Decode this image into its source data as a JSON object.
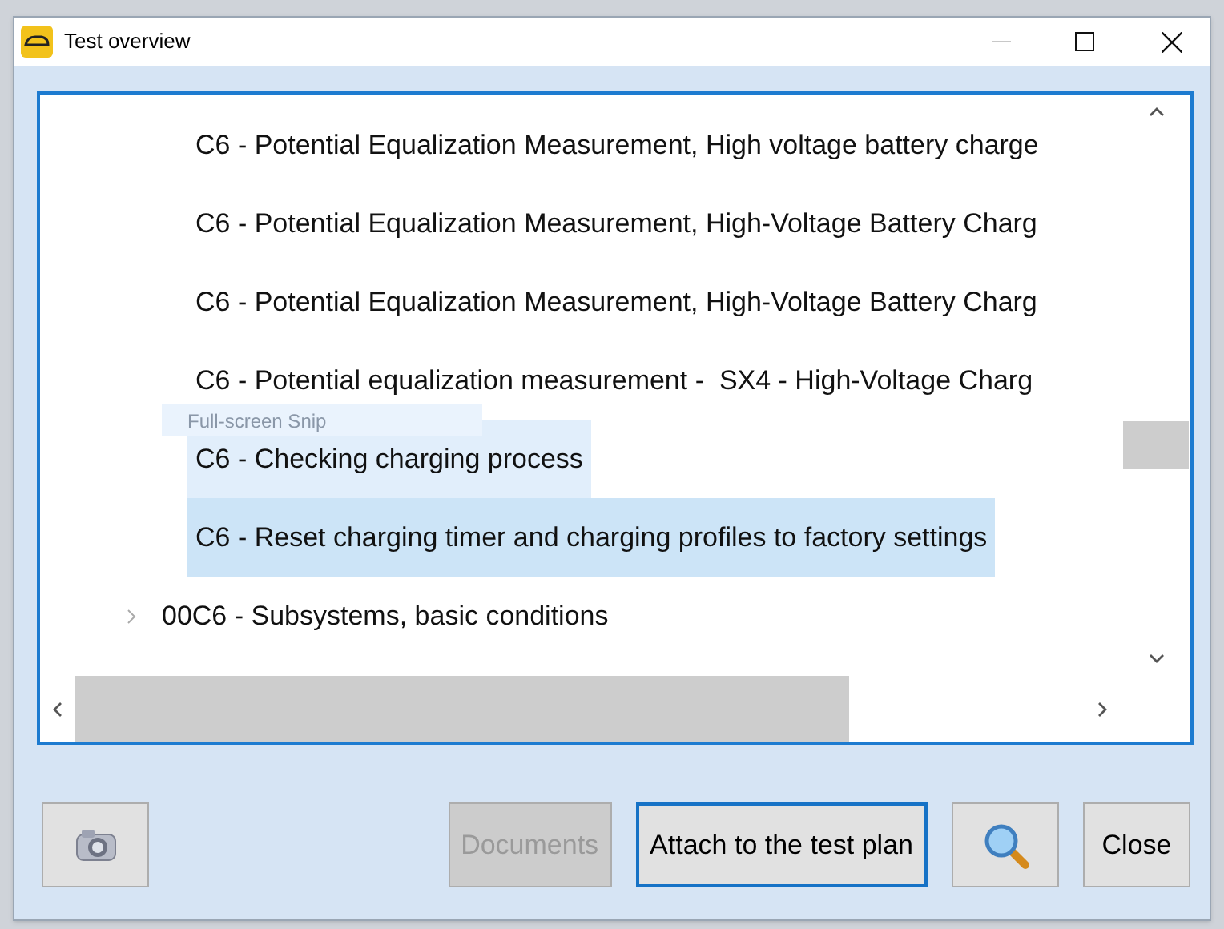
{
  "window": {
    "title": "Test overview"
  },
  "tree": {
    "items": [
      {
        "kind": "leaf",
        "label": "C6 - Potential Equalization Measurement, High voltage battery charge",
        "selected": false,
        "hovered": false
      },
      {
        "kind": "leaf",
        "label": "C6 - Potential Equalization Measurement, High-Voltage Battery Charg",
        "selected": false,
        "hovered": false
      },
      {
        "kind": "leaf",
        "label": "C6 - Potential Equalization Measurement, High-Voltage Battery Charg",
        "selected": false,
        "hovered": false
      },
      {
        "kind": "leaf",
        "label": "C6 - Potential equalization measurement -  SX4 - High-Voltage Charg",
        "selected": false,
        "hovered": false
      },
      {
        "kind": "leaf",
        "label": "C6 - Checking charging process",
        "selected": false,
        "hovered": true
      },
      {
        "kind": "leaf",
        "label": "C6 - Reset charging timer and charging profiles to factory settings",
        "selected": true,
        "hovered": false
      },
      {
        "kind": "node",
        "label": "00C6 - Subsystems, basic conditions",
        "selected": false,
        "hovered": false,
        "expanded": false
      }
    ]
  },
  "tooltip": "Full-screen Snip",
  "buttons": [
    {
      "kind": "camera",
      "disabled": false,
      "focused": false
    },
    {
      "kind": "text",
      "label": "Documents",
      "disabled": true,
      "focused": false
    },
    {
      "kind": "text",
      "label": "Attach to the test plan",
      "disabled": false,
      "focused": true
    },
    {
      "kind": "search",
      "disabled": false,
      "focused": false
    },
    {
      "kind": "text",
      "label": "Close",
      "disabled": false,
      "focused": false
    }
  ]
}
